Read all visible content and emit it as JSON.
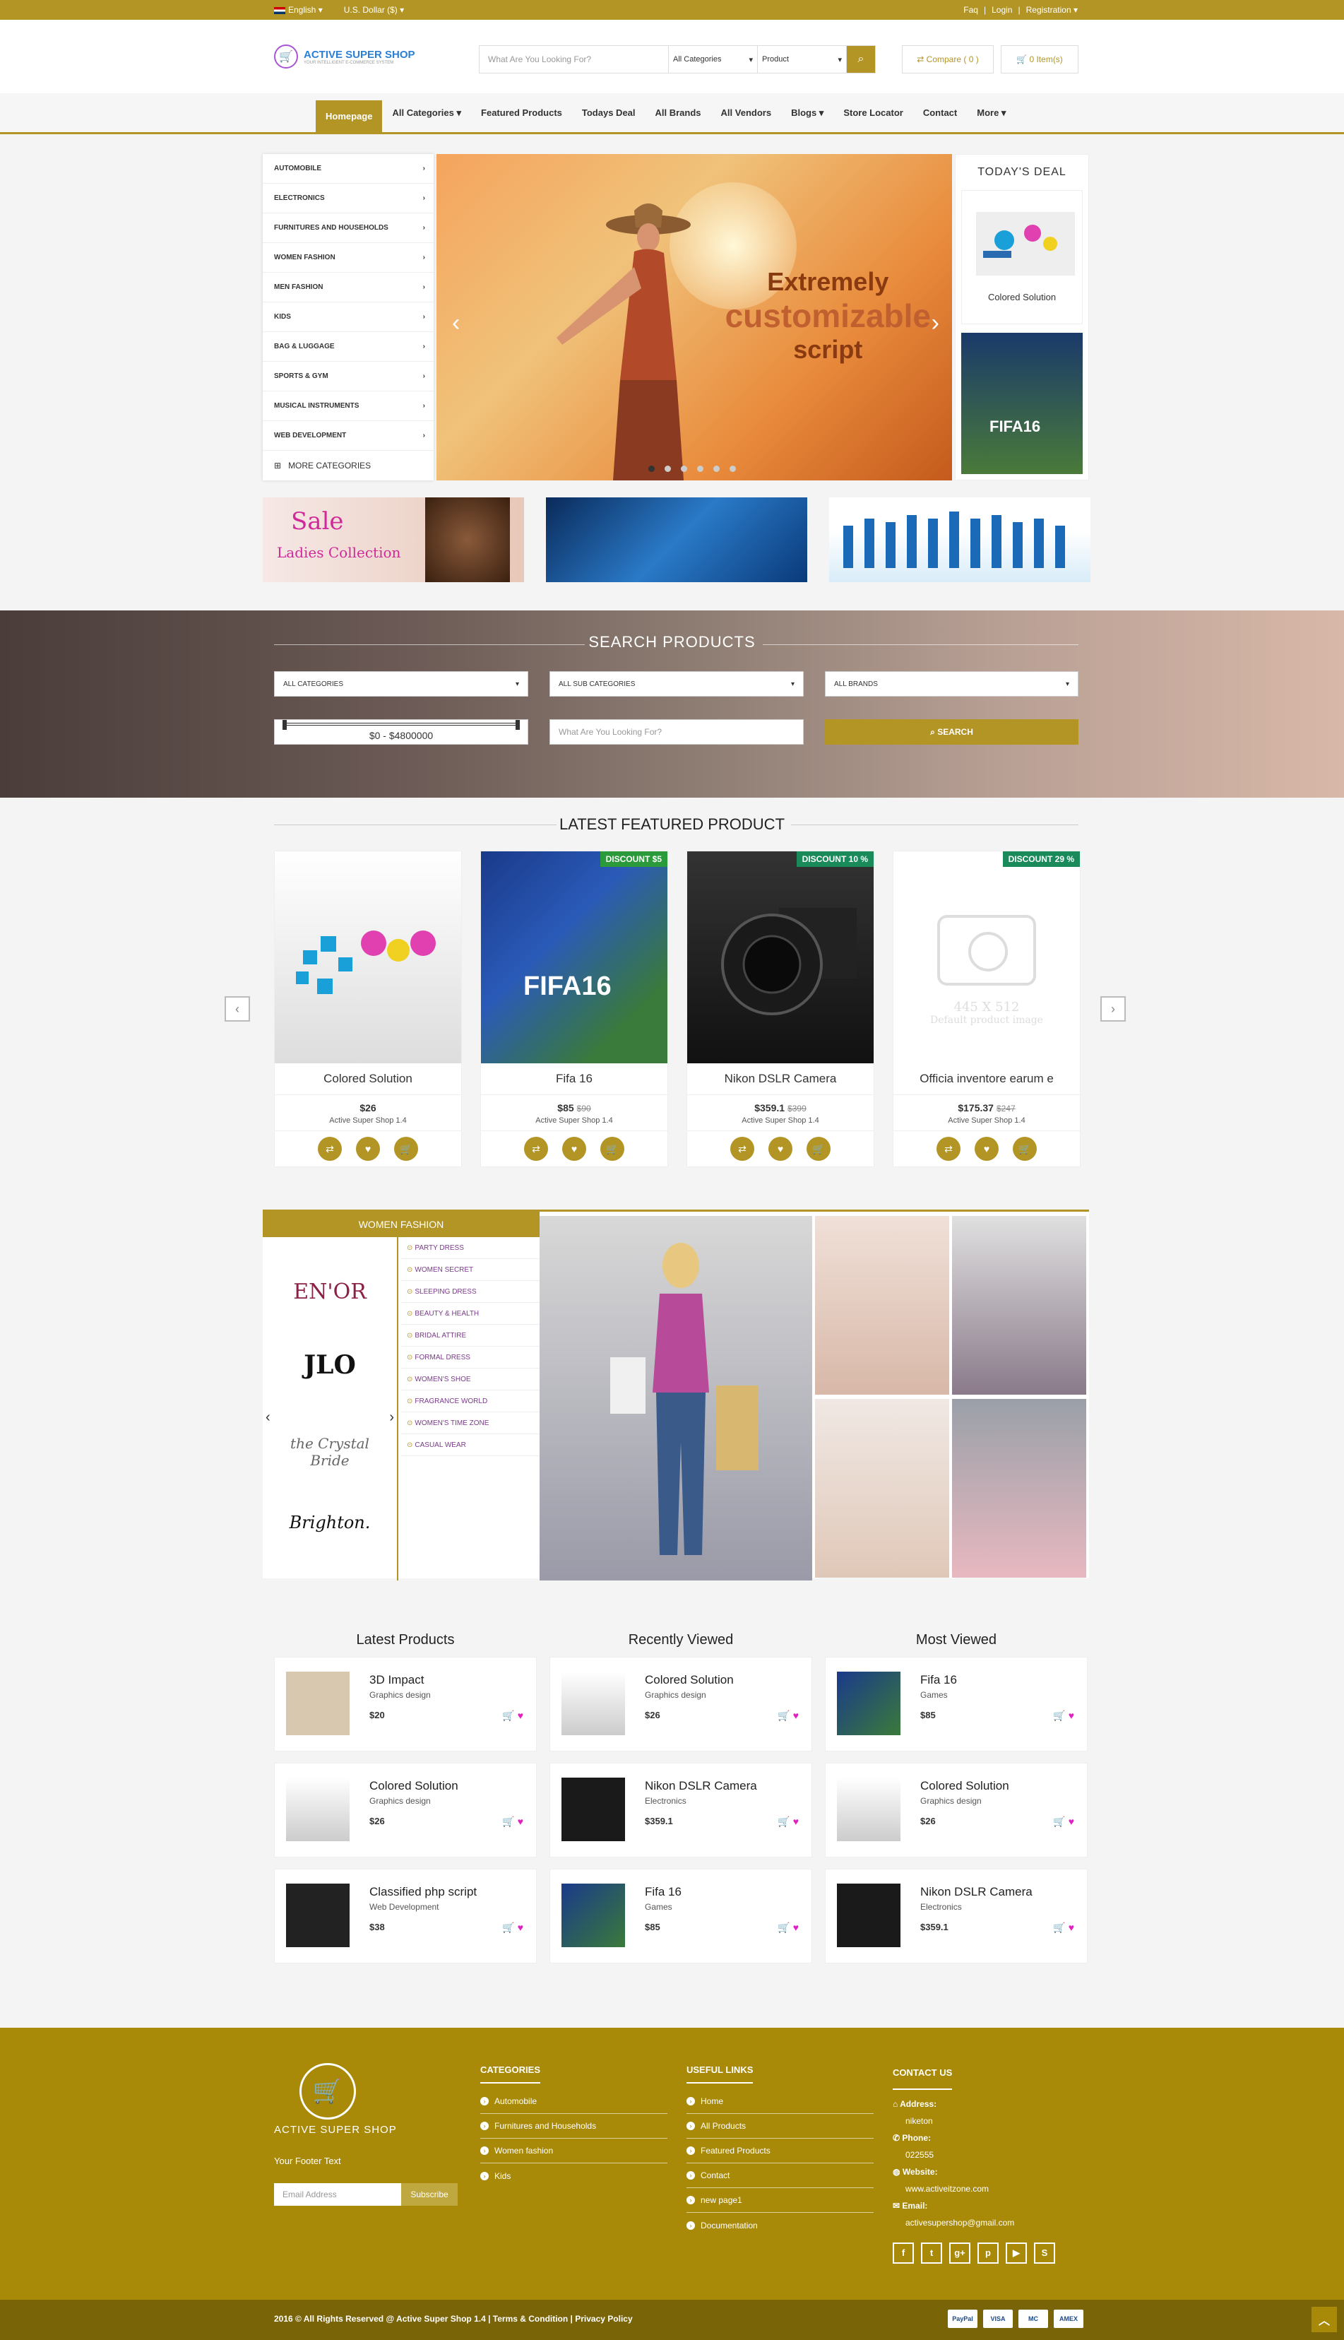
{
  "topbar": {
    "language": "English",
    "currency": "U.S. Dollar ($)",
    "faq": "Faq",
    "login": "Login",
    "registration": "Registration"
  },
  "header": {
    "logo_title": "ACTIVE SUPER SHOP",
    "logo_sub": "YOUR INTELLIGENT E-COMMERCE SYSTEM",
    "search_placeholder": "What Are You Looking For?",
    "category_select": "All Categories",
    "type_select": "Product",
    "compare": "Compare ( 0 )",
    "cart": "0 Item(s)"
  },
  "nav": [
    "Homepage",
    "All Categories",
    "Featured Products",
    "Todays Deal",
    "All Brands",
    "All Vendors",
    "Blogs",
    "Store Locator",
    "Contact",
    "More"
  ],
  "categories": [
    "AUTOMOBILE",
    "ELECTRONICS",
    "FURNITURES AND HOUSEHOLDS",
    "WOMEN FASHION",
    "MEN FASHION",
    "KIDS",
    "BAG & LUGGAGE",
    "SPORTS & GYM",
    "MUSICAL INSTRUMENTS",
    "WEB DEVELOPMENT"
  ],
  "more_categories": "MORE CATEGORIES",
  "slider": {
    "line1": "Extremely",
    "line2": "customizable",
    "line3": "script"
  },
  "todays_deal": {
    "title": "TODAY'S DEAL",
    "item": "Colored Solution"
  },
  "promo": {
    "sale": "Sale",
    "ladies": "Ladies Collection"
  },
  "search_section": {
    "title": "SEARCH PRODUCTS",
    "cat": "ALL CATEGORIES",
    "subcat": "ALL SUB CATEGORIES",
    "brands": "ALL BRANDS",
    "range": "$0 - $4800000",
    "placeholder": "What Are You Looking For?",
    "button": "SEARCH"
  },
  "featured": {
    "title": "LATEST FEATURED PRODUCT",
    "products": [
      {
        "name": "Colored Solution",
        "price": "$26",
        "old": "",
        "shop": "Active Super Shop 1.4",
        "badge": ""
      },
      {
        "name": "Fifa 16",
        "price": "$85",
        "old": "$90",
        "shop": "Active Super Shop 1.4",
        "badge": "DISCOUNT $5"
      },
      {
        "name": "Nikon DSLR Camera",
        "price": "$359.1",
        "old": "$399",
        "shop": "Active Super Shop 1.4",
        "badge": "DISCOUNT 10 %"
      },
      {
        "name": "Officia inventore earum e",
        "price": "$175.37",
        "old": "$247",
        "shop": "Active Super Shop 1.4",
        "badge": "DISCOUNT 29 %"
      }
    ],
    "placeholder_size": "445 X 512",
    "placeholder_text": "Default product image"
  },
  "women_fashion": {
    "title": "WOMEN FASHION",
    "brands": [
      "EN'OR",
      "JLO",
      "the Crystal Bride",
      "Brighton."
    ],
    "links": [
      "PARTY DRESS",
      "WOMEN SECRET",
      "SLEEPING DRESS",
      "BEAUTY & HEALTH",
      "BRIDAL ATTIRE",
      "FORMAL DRESS",
      "WOMEN'S SHOE",
      "FRAGRANCE WORLD",
      "WOMEN'S TIME ZONE",
      "CASUAL WEAR"
    ]
  },
  "lists": [
    {
      "title": "Latest Products",
      "items": [
        {
          "name": "3D Impact",
          "cat": "Graphics design",
          "price": "$20"
        },
        {
          "name": "Colored Solution",
          "cat": "Graphics design",
          "price": "$26"
        },
        {
          "name": "Classified php script",
          "cat": "Web Development",
          "price": "$38"
        }
      ]
    },
    {
      "title": "Recently Viewed",
      "items": [
        {
          "name": "Colored Solution",
          "cat": "Graphics design",
          "price": "$26"
        },
        {
          "name": "Nikon DSLR Camera",
          "cat": "Electronics",
          "price": "$359.1"
        },
        {
          "name": "Fifa 16",
          "cat": "Games",
          "price": "$85"
        }
      ]
    },
    {
      "title": "Most Viewed",
      "items": [
        {
          "name": "Fifa 16",
          "cat": "Games",
          "price": "$85"
        },
        {
          "name": "Colored Solution",
          "cat": "Graphics design",
          "price": "$26"
        },
        {
          "name": "Nikon DSLR Camera",
          "cat": "Electronics",
          "price": "$359.1"
        }
      ]
    }
  ],
  "footer": {
    "logo": "ACTIVE SUPER SHOP",
    "footer_text": "Your Footer Text",
    "email_placeholder": "Email Address",
    "subscribe": "Subscribe",
    "categories_title": "CATEGORIES",
    "categories": [
      "Automobile",
      "Furnitures and Households",
      "Women fashion",
      "Kids"
    ],
    "links_title": "USEFUL LINKS",
    "links": [
      "Home",
      "All Products",
      "Featured Products",
      "Contact",
      "new page1",
      "Documentation"
    ],
    "contact_title": "CONTACT US",
    "address_label": "Address:",
    "address": "niketon",
    "phone_label": "Phone:",
    "phone": "022555",
    "website_label": "Website:",
    "website": "www.activeitzone.com",
    "email_label": "Email:",
    "email": "activesupershop@gmail.com",
    "copyright": "2016 © All Rights Reserved @ Active Super Shop 1.4 | Terms & Condition | Privacy Policy",
    "payments": [
      "PayPal",
      "VISA",
      "MC",
      "AMEX"
    ]
  }
}
